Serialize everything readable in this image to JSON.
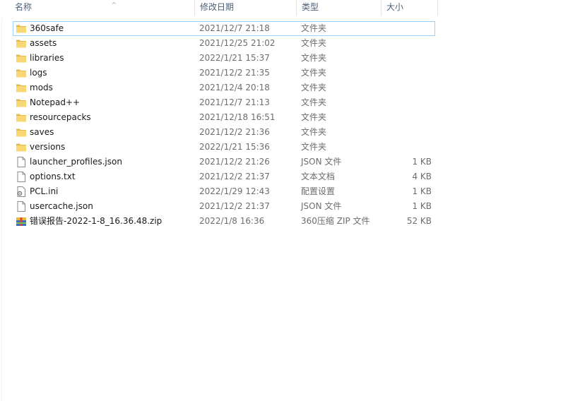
{
  "columns": {
    "name": "名称",
    "date": "修改日期",
    "type": "类型",
    "size": "大小"
  },
  "files": [
    {
      "name": "360safe",
      "date": "2021/12/7 21:18",
      "type": "文件夹",
      "size": "",
      "icon": "folder-icon",
      "selected": true
    },
    {
      "name": "assets",
      "date": "2021/12/25 21:02",
      "type": "文件夹",
      "size": "",
      "icon": "folder-icon"
    },
    {
      "name": "libraries",
      "date": "2022/1/21 15:37",
      "type": "文件夹",
      "size": "",
      "icon": "folder-icon"
    },
    {
      "name": "logs",
      "date": "2021/12/2 21:35",
      "type": "文件夹",
      "size": "",
      "icon": "folder-icon"
    },
    {
      "name": "mods",
      "date": "2021/12/4 20:18",
      "type": "文件夹",
      "size": "",
      "icon": "folder-icon"
    },
    {
      "name": "Notepad++",
      "date": "2021/12/7 21:13",
      "type": "文件夹",
      "size": "",
      "icon": "folder-icon"
    },
    {
      "name": "resourcepacks",
      "date": "2021/12/18 16:51",
      "type": "文件夹",
      "size": "",
      "icon": "folder-icon"
    },
    {
      "name": "saves",
      "date": "2021/12/2 21:36",
      "type": "文件夹",
      "size": "",
      "icon": "folder-icon"
    },
    {
      "name": "versions",
      "date": "2022/1/21 15:36",
      "type": "文件夹",
      "size": "",
      "icon": "folder-icon"
    },
    {
      "name": "launcher_profiles.json",
      "date": "2021/12/2 21:26",
      "type": "JSON 文件",
      "size": "1 KB",
      "icon": "file-icon"
    },
    {
      "name": "options.txt",
      "date": "2021/12/2 21:37",
      "type": "文本文档",
      "size": "4 KB",
      "icon": "file-icon"
    },
    {
      "name": "PCL.ini",
      "date": "2022/1/29 12:43",
      "type": "配置设置",
      "size": "1 KB",
      "icon": "settings-file-icon"
    },
    {
      "name": "usercache.json",
      "date": "2021/12/2 21:37",
      "type": "JSON 文件",
      "size": "1 KB",
      "icon": "file-icon"
    },
    {
      "name": "错误报告-2022-1-8_16.36.48.zip",
      "date": "2022/1/8 16:36",
      "type": "360压缩 ZIP 文件",
      "size": "52 KB",
      "icon": "zip-archive-icon"
    }
  ],
  "colors": {
    "selection_border": "#99d1ff",
    "folder_yellow": "#f8d775",
    "header_text": "#4c607a"
  }
}
